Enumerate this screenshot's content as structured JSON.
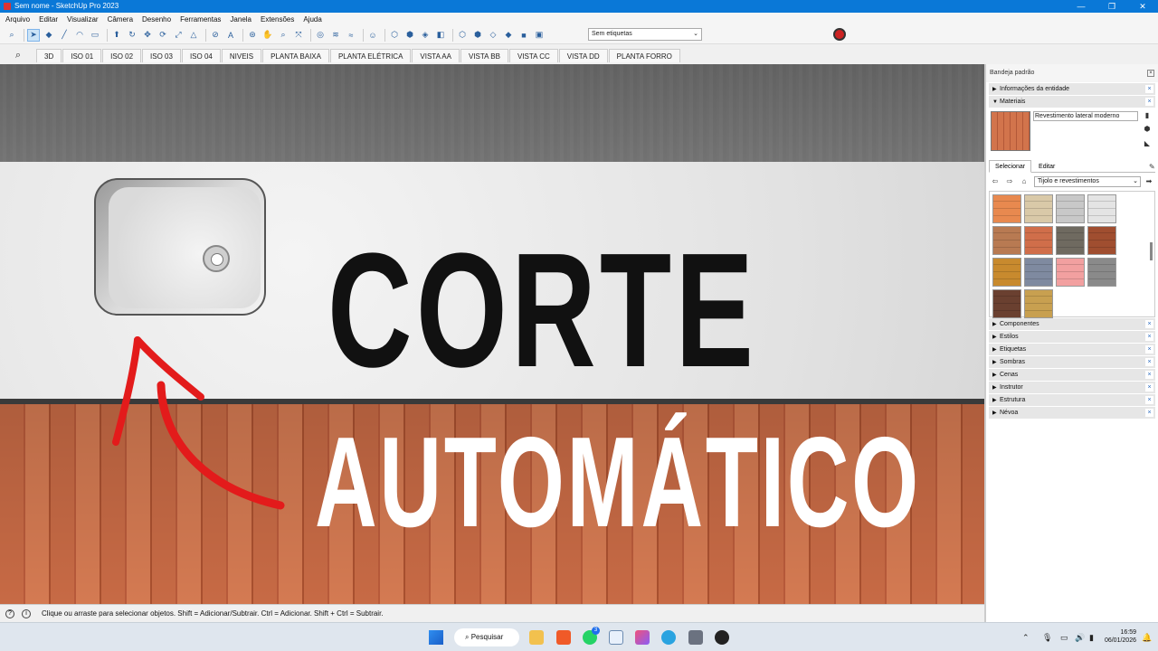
{
  "window": {
    "title": "Sem nome - SketchUp Pro 2023",
    "controls": [
      "—",
      "❐",
      "✕"
    ]
  },
  "menu": [
    "Arquivo",
    "Editar",
    "Visualizar",
    "Câmera",
    "Desenho",
    "Ferramentas",
    "Janela",
    "Extensões",
    "Ajuda"
  ],
  "toolbar": {
    "tag_select": "Sem etiquetas"
  },
  "scenes": [
    "3D",
    "ISO 01",
    "ISO 02",
    "ISO 03",
    "ISO 04",
    "NIVEIS",
    "PLANTA BAIXA",
    "PLANTA ELÉTRICA",
    "VISTA AA",
    "VISTA BB",
    "VISTA CC",
    "VISTA DD",
    "PLANTA FORRO"
  ],
  "overlay": {
    "line1": "CORTE",
    "line2": "AUTOMÁTICO"
  },
  "status": {
    "text": "Clique ou arraste para selecionar objetos. Shift = Adicionar/Subtrair. Ctrl = Adicionar. Shift + Ctrl = Subtrair."
  },
  "panel": {
    "title": "Bandeja padrão",
    "entity_info": "Informações da entidade",
    "materials": "Materiais",
    "material_name": "Revestimento lateral moderno",
    "tabs": [
      "Selecionar",
      "Editar"
    ],
    "library": "Tijolo e revestimentos",
    "collapsed_sections": [
      "Componentes",
      "Estilos",
      "Etiquetas",
      "Sombras",
      "Cenas",
      "Instrutor",
      "Estrutura",
      "Névoa"
    ],
    "swatch_colors": [
      "#e8894f",
      "#d9c9a8",
      "#c8c8c8",
      "#e4e4e4",
      "#b87a52",
      "#d06e4a",
      "#6f6a60",
      "#a04e30",
      "#c88a2e",
      "#7f8aa0",
      "#f2a0a0",
      "#8a8a8a",
      "#6a4030",
      "#c8a050"
    ]
  },
  "taskbar": {
    "search": "Pesquisar",
    "time": "16:59",
    "date": "06/01/2026",
    "badge": "3"
  }
}
